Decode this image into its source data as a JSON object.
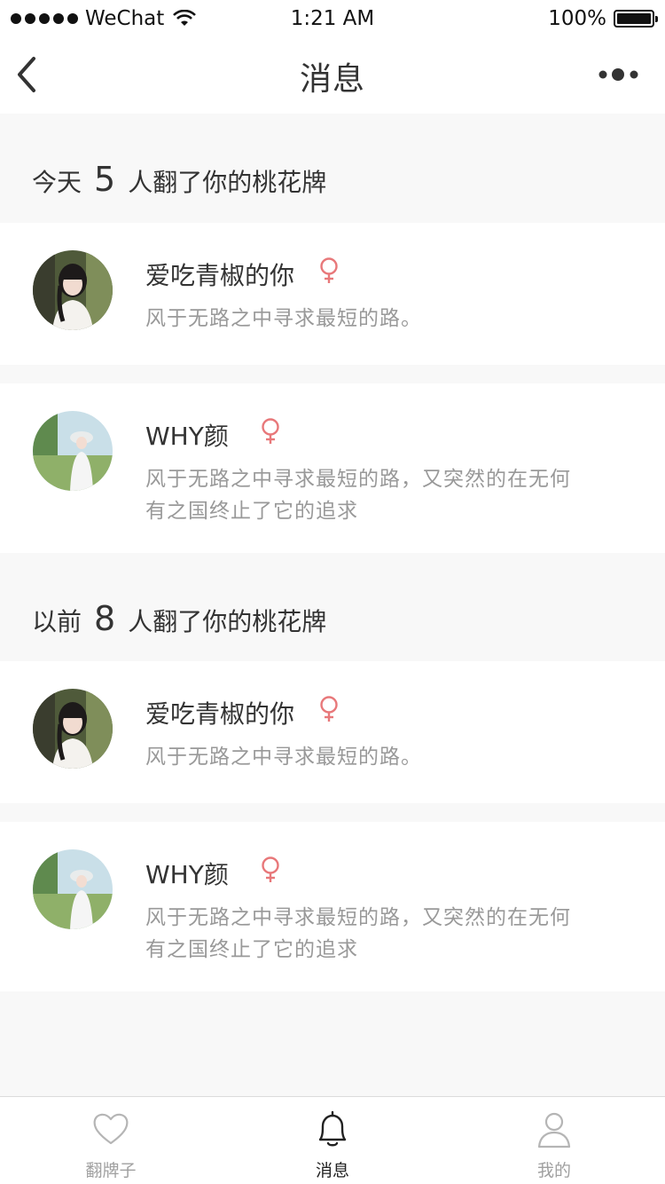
{
  "status_bar": {
    "carrier": "WeChat",
    "time": "1:21 AM",
    "battery": "100%"
  },
  "nav": {
    "title": "消息",
    "back_icon": "chevron-left-icon",
    "more_icon": "more-dots-icon"
  },
  "sections": [
    {
      "prefix": "今天",
      "count": "5",
      "suffix": "人翻了你的桃花牌"
    },
    {
      "prefix": "以前",
      "count": "8",
      "suffix": "人翻了你的桃花牌"
    }
  ],
  "messages": [
    {
      "name": "爱吃青椒的你",
      "gender_icon": "female-icon",
      "line1": "风于无路之中寻求最短的路。",
      "line2": ""
    },
    {
      "name": "WHY颜",
      "gender_icon": "female-icon",
      "line1": "风于无路之中寻求最短的路，又突然的在无何",
      "line2": "有之国终止了它的追求"
    },
    {
      "name": "爱吃青椒的你",
      "gender_icon": "female-icon",
      "line1": "风于无路之中寻求最短的路。",
      "line2": ""
    },
    {
      "name": "WHY颜",
      "gender_icon": "female-icon",
      "line1": "风于无路之中寻求最短的路，又突然的在无何",
      "line2": "有之国终止了它的追求"
    }
  ],
  "tabs": [
    {
      "label": "翻牌子",
      "icon": "heart-icon",
      "active": false
    },
    {
      "label": "消息",
      "icon": "bell-icon",
      "active": true
    },
    {
      "label": "我的",
      "icon": "user-icon",
      "active": false
    }
  ],
  "colors": {
    "accent_female": "#e8787a",
    "background": "#f8f8f8",
    "text_primary": "#333333",
    "text_secondary": "#999999"
  }
}
